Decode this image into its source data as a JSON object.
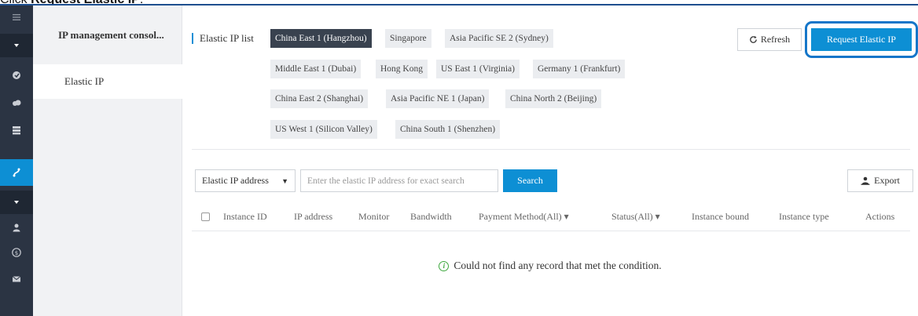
{
  "caption": {
    "prefix": "Click ",
    "target": "Request Elastic IP",
    "suffix": "."
  },
  "sidebar": {
    "title": "IP management consol...",
    "items": [
      {
        "label": "Elastic IP"
      }
    ]
  },
  "page": {
    "label": "Elastic IP list"
  },
  "regions": [
    {
      "label": "China East 1 (Hangzhou)",
      "active": true
    },
    {
      "label": "Singapore"
    },
    {
      "label": "Asia Pacific SE 2 (Sydney)"
    },
    {
      "label": "Middle East 1 (Dubai)"
    },
    {
      "label": "Hong Kong"
    },
    {
      "label": "US East 1 (Virginia)"
    },
    {
      "label": "Germany 1 (Frankfurt)"
    },
    {
      "label": "China East 2 (Shanghai)"
    },
    {
      "label": "Asia Pacific NE 1 (Japan)"
    },
    {
      "label": "China North 2 (Beijing)"
    },
    {
      "label": "US West 1 (Silicon Valley)"
    },
    {
      "label": "China South 1 (Shenzhen)"
    }
  ],
  "toolbar": {
    "refresh_label": "Refresh",
    "request_label": "Request Elastic IP"
  },
  "search": {
    "select_value": "Elastic IP address",
    "placeholder": "Enter the elastic IP address for exact search",
    "button_label": "Search",
    "export_label": "Export"
  },
  "table": {
    "columns": [
      "Instance ID",
      "IP address",
      "Monitor",
      "Bandwidth",
      "Payment Method(All) ▾",
      "Status(All) ▾",
      "Instance bound",
      "Instance type",
      "Actions"
    ],
    "empty_message": "Could not find any record that met the condition."
  },
  "colors": {
    "accent": "#0d8fd4",
    "iconbar": "#2b3443",
    "active_region": "#39424f",
    "highlight_ring": "#1576c9"
  },
  "icons": {
    "iconbar": [
      "menu-icon",
      "chevron-down-icon",
      "shield-icon",
      "cloud-icon",
      "server-icon",
      "elastic-ip-icon",
      "chevron-down-icon",
      "user-icon",
      "billing-icon",
      "mail-icon"
    ],
    "refresh": "refresh-icon",
    "export": "export-icon",
    "empty": "info-icon"
  }
}
